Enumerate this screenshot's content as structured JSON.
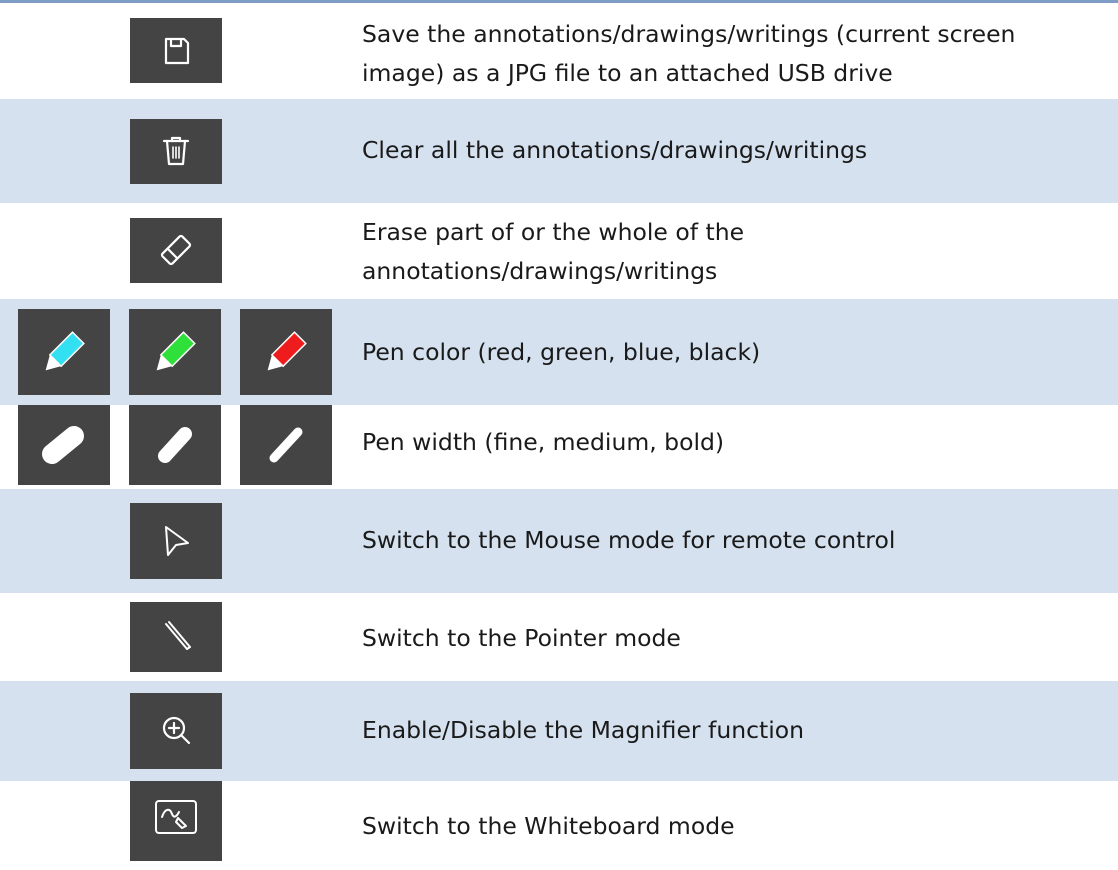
{
  "rows": [
    {
      "description": "Save the annotations/drawings/writings (current screen image) as a JPG file to an attached USB drive",
      "icons": [
        "save-icon"
      ]
    },
    {
      "description": "Clear all the annotations/drawings/writings",
      "icons": [
        "trash-icon"
      ]
    },
    {
      "description": "Erase part of or the whole of the annotations/drawings/writings",
      "icons": [
        "eraser-icon"
      ]
    },
    {
      "description": "Pen color (red, green, blue, black)",
      "icons": [
        "blue-pen-icon",
        "green-pen-icon",
        "red-pen-icon"
      ]
    },
    {
      "description": "Pen width (fine, medium, bold)",
      "icons": [
        "pen-width-bold-icon",
        "pen-width-medium-icon",
        "pen-width-fine-icon"
      ]
    },
    {
      "description": "Switch to the Mouse mode for remote control",
      "icons": [
        "mouse-cursor-icon"
      ]
    },
    {
      "description": "Switch to the Pointer mode",
      "icons": [
        "pointer-icon"
      ]
    },
    {
      "description": "Enable/Disable the Magnifier function",
      "icons": [
        "magnifier-icon"
      ]
    },
    {
      "description": "Switch to the Whiteboard mode",
      "icons": [
        "whiteboard-icon"
      ]
    }
  ],
  "colors": {
    "icon_bg": "#444444",
    "row_shade": "#d5e1ef",
    "pen_blue": "#33e0f2",
    "pen_green": "#2fdf3a",
    "pen_red": "#ee1c1c",
    "top_rule": "#7f9cc6"
  }
}
